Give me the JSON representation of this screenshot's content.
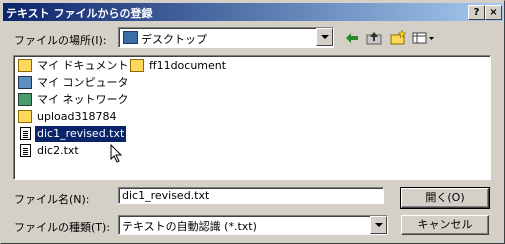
{
  "window": {
    "title": "テキスト ファイルからの登録",
    "help_button": "?",
    "close_button": "×"
  },
  "location": {
    "label": "ファイルの場所(I):",
    "value": "デスクトップ"
  },
  "toolbar": {
    "back_icon": "back-arrow-icon",
    "up_icon": "up-folder-icon",
    "new_folder_icon": "new-folder-icon",
    "view_icon": "view-menu-icon"
  },
  "files": {
    "col1": [
      {
        "label": "マイ ドキュメント",
        "icon": "my-documents-icon"
      },
      {
        "label": "マイ コンピュータ",
        "icon": "my-computer-icon"
      },
      {
        "label": "マイ ネットワーク",
        "icon": "my-network-icon"
      },
      {
        "label": "upload318784",
        "icon": "folder-icon"
      },
      {
        "label": "dic1_revised.txt",
        "icon": "text-file-icon",
        "selected": true
      },
      {
        "label": "dic2.txt",
        "icon": "text-file-icon"
      }
    ],
    "col2": [
      {
        "label": "ff11document",
        "icon": "folder-shortcut-icon"
      }
    ]
  },
  "filename": {
    "label": "ファイル名(N):",
    "value": "dic1_revised.txt"
  },
  "filetype": {
    "label": "ファイルの種類(T):",
    "value": "テキストの自動認識 (*.txt)"
  },
  "buttons": {
    "open": "開く(O)",
    "cancel": "キャンセル"
  }
}
